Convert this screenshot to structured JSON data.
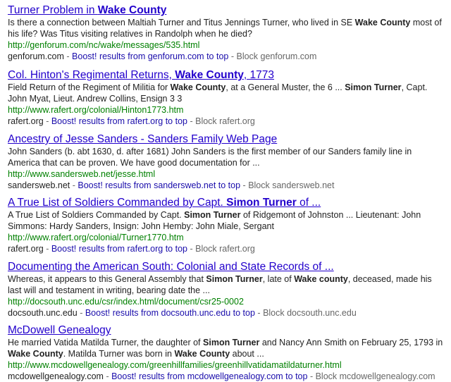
{
  "results": [
    {
      "title": [
        {
          "t": "Turner Problem in "
        },
        {
          "t": "Wake County",
          "b": true
        }
      ],
      "snippet": [
        {
          "t": "Is there a connection between Maltiah Turner and Titus Jennings Turner, who lived in SE "
        },
        {
          "t": "Wake County",
          "b": true
        },
        {
          "t": " most of his life? Was Titus visiting relatives in Randolph when he died?"
        }
      ],
      "url": "http://genforum.com/nc/wake/messages/535.html",
      "domain": "genforum.com",
      "boost_label": "Boost! results from genforum.com to top",
      "block_label": "Block genforum.com"
    },
    {
      "title": [
        {
          "t": "Col. Hinton's Regimental Returns, "
        },
        {
          "t": "Wake County",
          "b": true
        },
        {
          "t": ", 1773"
        }
      ],
      "snippet": [
        {
          "t": "Field Return of the Regiment of Militia for "
        },
        {
          "t": "Wake County",
          "b": true
        },
        {
          "t": ", at a General Muster, the 6 ... "
        },
        {
          "t": "Simon Turner",
          "b": true
        },
        {
          "t": ", Capt. John Myat, Lieut. Andrew Collins, Ensign 3 3"
        }
      ],
      "url": "http://www.rafert.org/colonial/Hinton1773.htm",
      "domain": "rafert.org",
      "boost_label": "Boost! results from rafert.org to top",
      "block_label": "Block rafert.org"
    },
    {
      "title": [
        {
          "t": "Ancestry of Jesse Sanders - Sanders Family Web Page"
        }
      ],
      "snippet": [
        {
          "t": "John Sanders (b. abt 1630, d. after 1681) John Sanders is the first member of our Sanders family line in America that can be proven. We have good documentation for ..."
        }
      ],
      "url": "http://www.sandersweb.net/jesse.html",
      "domain": "sandersweb.net",
      "boost_label": "Boost! results from sandersweb.net to top",
      "block_label": "Block sandersweb.net"
    },
    {
      "title": [
        {
          "t": "A True List of Soldiers Commanded by Capt. "
        },
        {
          "t": "Simon Turner",
          "b": true
        },
        {
          "t": " of ..."
        }
      ],
      "snippet": [
        {
          "t": "A True List of Soldiers Commanded by Capt. "
        },
        {
          "t": "Simon Turner",
          "b": true
        },
        {
          "t": " of Ridgemont of Johnston ... Lieutenant: John Simmons: Hardy Sanders, Insign: John Hemby: John Miale, Sergant"
        }
      ],
      "url": "http://www.rafert.org/colonial/Turner1770.htm",
      "domain": "rafert.org",
      "boost_label": "Boost! results from rafert.org to top",
      "block_label": "Block rafert.org"
    },
    {
      "title": [
        {
          "t": "Documenting the American South: Colonial and State Records of ..."
        }
      ],
      "snippet": [
        {
          "t": "Whereas, it appears to this General Assembly that "
        },
        {
          "t": "Simon Turner",
          "b": true
        },
        {
          "t": ", late of "
        },
        {
          "t": "Wake county",
          "b": true
        },
        {
          "t": ", deceased, made his last will and testament in writing, bearing date the ..."
        }
      ],
      "url": "http://docsouth.unc.edu/csr/index.html/document/csr25-0002",
      "domain": "docsouth.unc.edu",
      "boost_label": "Boost! results from docsouth.unc.edu to top",
      "block_label": "Block docsouth.unc.edu"
    },
    {
      "title": [
        {
          "t": "McDowell Genealogy"
        }
      ],
      "snippet": [
        {
          "t": "He married Vatida Matilda Turner, the daughter of "
        },
        {
          "t": "Simon Turner",
          "b": true
        },
        {
          "t": " and Nancy Ann Smith on February 25, 1793 in "
        },
        {
          "t": "Wake County",
          "b": true
        },
        {
          "t": ". Matilda Turner was born in "
        },
        {
          "t": "Wake County",
          "b": true
        },
        {
          "t": " about ..."
        }
      ],
      "url": "http://www.mcdowellgenealogy.com/greenhillfamilies/greenhillvatidamatildaturner.html",
      "domain": "mcdowellgenealogy.com",
      "boost_label": "Boost! results from mcdowellgenealogy.com to top",
      "block_label": "Block mcdowellgenealogy.com"
    }
  ]
}
